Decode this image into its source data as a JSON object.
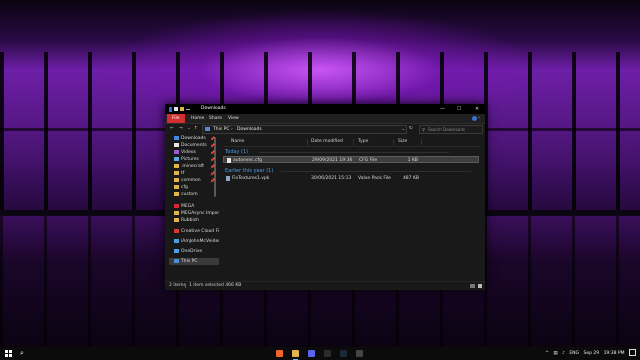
{
  "window": {
    "title": "Downloads",
    "minimize": "—",
    "maximize": "☐",
    "close": "✕",
    "ribbon_tabs": [
      "File",
      "Home",
      "Share",
      "View"
    ],
    "ribbon_collapse": "⌄"
  },
  "address": {
    "back": "←",
    "forward": "→",
    "recent": "⌄",
    "up": "↑",
    "path": [
      "This PC",
      "Downloads"
    ],
    "separator": "›",
    "dropdown": "⌄",
    "refresh": "↻",
    "search_placeholder": "Search Downloads"
  },
  "nav_pane": {
    "items": [
      {
        "label": "Downloads",
        "pinned": true,
        "color": "#3c8be0"
      },
      {
        "label": "Documents",
        "pinned": true,
        "color": "#e6e6e6"
      },
      {
        "label": "Videos",
        "pinned": true,
        "color": "#9b59d6"
      },
      {
        "label": "Pictures",
        "pinned": true,
        "color": "#5aa7e6"
      },
      {
        "label": ".minecraft",
        "pinned": true,
        "color": "#e1b54c"
      },
      {
        "label": "tf",
        "pinned": true,
        "color": "#e1b54c"
      },
      {
        "label": "common",
        "pinned": true,
        "color": "#e1b54c"
      },
      {
        "label": "cfg",
        "pinned": false,
        "color": "#e1b54c"
      },
      {
        "label": "custom",
        "pinned": false,
        "color": "#e1b54c"
      },
      {
        "label": "MEGA",
        "pinned": false,
        "color": "#d9272e"
      },
      {
        "label": "MEGAsync Imports",
        "pinned": false,
        "color": "#e1b54c"
      },
      {
        "label": "Rubbish",
        "pinned": false,
        "color": "#e1b54c"
      },
      {
        "label": "Creative Cloud Files",
        "pinned": false,
        "color": "#d9392e"
      },
      {
        "label": "iAmJohnMcVeiden Di",
        "pinned": false,
        "color": "#4f9fe6"
      },
      {
        "label": "OneDrive",
        "pinned": false,
        "color": "#4f9fe6"
      },
      {
        "label": "This PC",
        "pinned": false,
        "color": "#4c8fd9"
      }
    ],
    "pin_glyph": "📌"
  },
  "columns": {
    "name": "Name",
    "date": "Date modified",
    "type": "Type",
    "size": "Size"
  },
  "groups": [
    {
      "label": "Today (1)",
      "files": [
        {
          "name": "autoexec.cfg",
          "date": "29/09/2021 19:36",
          "type": "CFG File",
          "size": "1 KB",
          "selected": true
        }
      ]
    },
    {
      "label": "Earlier this year (1)",
      "files": [
        {
          "name": "FixTextures1.vpk",
          "date": "30/06/2021 15:13",
          "type": "Valve Pack File",
          "size": "487 KB",
          "selected": false
        }
      ]
    }
  ],
  "status": {
    "items": "2 items",
    "selected": "1 item selected  466 KB"
  },
  "taskbar": {
    "search_glyph": "⌕",
    "apps": [
      {
        "name": "brave",
        "color": "#f2642b",
        "active": false
      },
      {
        "name": "file-explorer",
        "color": "#e1b54c",
        "active": true
      },
      {
        "name": "discord",
        "color": "#5865f2",
        "active": false
      },
      {
        "name": "obs",
        "color": "#2b2b2b",
        "active": false
      },
      {
        "name": "steam",
        "color": "#1b2838",
        "active": false
      },
      {
        "name": "clock-app",
        "color": "#444444",
        "active": false
      }
    ],
    "tray_expand": "^",
    "lang": "ENG",
    "date": "Sep 29",
    "time": "19:38 PM"
  }
}
